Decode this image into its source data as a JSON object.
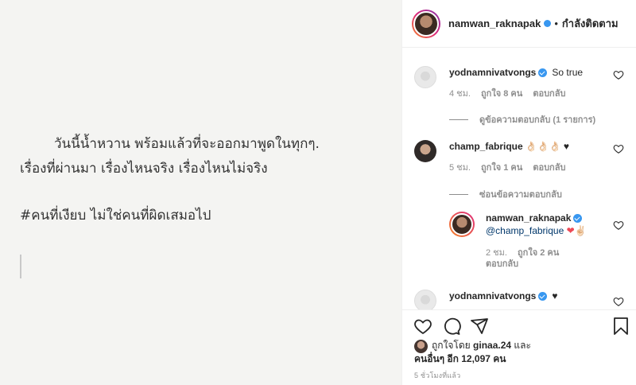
{
  "post": {
    "line1": "วันนี้น้ำหวาน พร้อมแล้วที่จะออกมาพูดในทุกๆ.",
    "line2": "เรื่องที่ผ่านมา เรื่องไหนจริง เรื่องไหนไม่จริง",
    "line3": "#คนที่เงียบ ไม่ใช่คนที่ผิดเสมอไป"
  },
  "header": {
    "username": "namwan_raknapak",
    "dot": "•",
    "follow_status": "กำลังติดตาม"
  },
  "comments": [
    {
      "username": "yodnamnivatvongs",
      "text": "So true",
      "time": "4 ชม.",
      "likes": "ถูกใจ 8 คน",
      "reply": "ตอบกลับ",
      "view_replies": "ดูข้อความตอบกลับ (1 รายการ)"
    },
    {
      "username": "champ_fabrique",
      "text": "👌🏻👌🏻👌🏻 ♥",
      "time": "5 ชม.",
      "likes": "ถูกใจ 1 คน",
      "reply": "ตอบกลับ",
      "hide_replies": "ซ่อนข้อความตอบกลับ"
    },
    {
      "username": "namwan_raknapak",
      "mention": "@champ_fabrique",
      "emoji": "❤✌🏻",
      "time": "2 ชม.",
      "likes": "ถูกใจ 2 คน",
      "reply": "ตอบกลับ"
    },
    {
      "username": "yodnamnivatvongs",
      "text": "♥"
    }
  ],
  "liked_by": {
    "prefix": "ถูกใจโดย",
    "user": "ginaa.24",
    "and": "และ",
    "others": "คนอื่นๆ อีก 12,097 คน"
  },
  "timestamp": "5 ชั่วโมงที่แล้ว",
  "colors": {
    "verified": "#3897f0",
    "muted": "#8e8e8e",
    "heart_red": "#ed4956"
  }
}
